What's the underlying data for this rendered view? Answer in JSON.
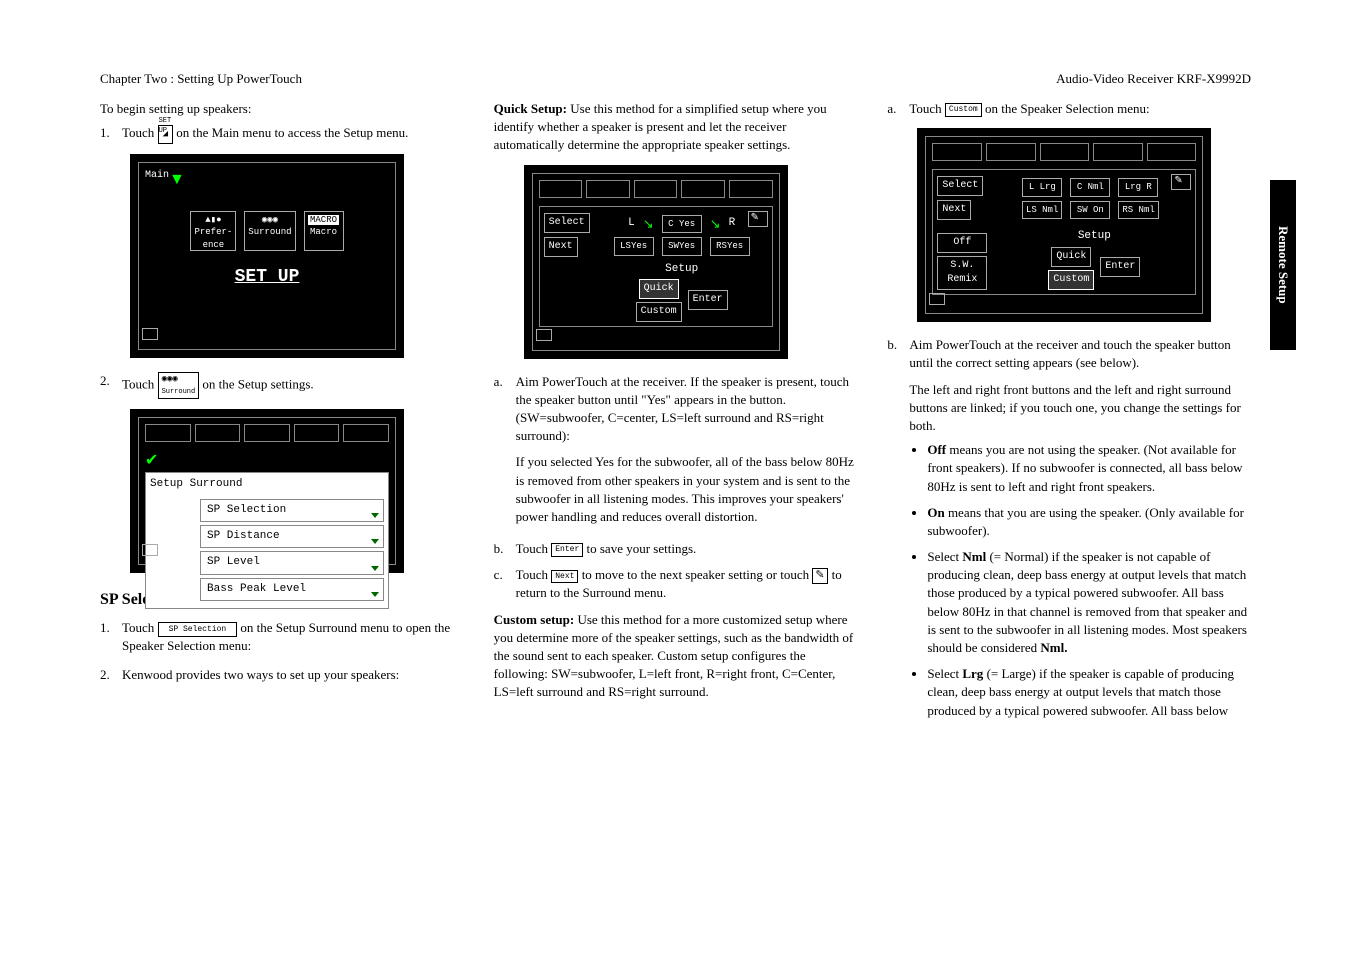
{
  "header": {
    "chapter": "Chapter Two : Setting Up PowerTouch",
    "product": "Audio-Video Receiver KRF-X9992D"
  },
  "side_tab": "Remote Setup",
  "col1": {
    "intro": "To begin setting up speakers:",
    "step1_pre": "Touch ",
    "step1_icon_label": "SET UP",
    "step1_post": " on the Main menu to access the Setup menu.",
    "screen1": {
      "main_label": "Main",
      "items": [
        "Prefer-\nence",
        "Surround",
        "Macro"
      ],
      "macro_box": "MACRO",
      "big": "SET UP"
    },
    "step2_pre": "Touch ",
    "step2_post": " on the Setup settings.",
    "screen2": {
      "title": "Setup Surround",
      "items": [
        "SP Selection",
        "SP Distance",
        "SP Level",
        "Bass Peak Level"
      ]
    },
    "section_heading": "SP Selection",
    "sp_step1_pre": "Touch ",
    "sp_step1_btn": "SP Selection",
    "sp_step1_post": " on the Setup Surround menu to open the Speaker Selection menu:",
    "sp_step2": "Kenwood provides two ways to set up your speakers:"
  },
  "col2": {
    "quick_setup_label": "Quick Setup:",
    "quick_setup_text": "  Use this method for a simplified setup where you identify whether a speaker is present and let the receiver automatically determine the appropriate speaker settings.",
    "screen3": {
      "select": "Select",
      "next": "Next",
      "L": "L",
      "R": "R",
      "c_yes": "C Yes",
      "ls": "LSYes",
      "sw": "SWYes",
      "rs": "RSYes",
      "setup": "Setup",
      "quick": "Quick",
      "custom": "Custom",
      "enter": "Enter"
    },
    "sub_a": "Aim PowerTouch at the receiver. If the speaker is present, touch the speaker button until \"Yes\" appears in the button. (SW=subwoofer, C=center, LS=left surround and RS=right surround):",
    "sub_a_para2": "If you selected Yes for the subwoofer, all of the bass below 80Hz is removed from other speakers in your system and is sent to the subwoofer in all listening modes. This improves your speakers' power handling and reduces overall distortion.",
    "sub_b_pre": "Touch ",
    "sub_b_btn": "Enter",
    "sub_b_post": " to save your settings.",
    "sub_c_pre": "Touch ",
    "sub_c_btn": "Next",
    "sub_c_mid": " to move to the next speaker setting or touch ",
    "sub_c_post": " to return to the Surround menu.",
    "custom_label": "Custom setup:",
    "custom_text": "  Use this method for a more customized setup where you determine more of the speaker settings, such as the bandwidth of the sound sent to each speaker. Custom setup configures the following: SW=subwoofer, L=left front, R=right front, C=Center, LS=left surround and RS=right surround."
  },
  "col3": {
    "sub_a_pre": "Touch ",
    "sub_a_btn": "Custom",
    "sub_a_post": " on the Speaker Selection menu:",
    "screen4": {
      "select": "Select",
      "next": "Next",
      "l_lrg": "L Lrg",
      "c_nml": "C Nml",
      "lrg_r": "Lrg R",
      "ls_nml": "LS Nml",
      "sw_on": "SW On",
      "rs_nml": "RS Nml",
      "off": "Off",
      "sw_remix": "S.W.\nRemix",
      "setup": "Setup",
      "quick": "Quick",
      "custom": "Custom",
      "enter": "Enter"
    },
    "sub_b": "Aim PowerTouch at the receiver and touch the speaker button until the correct setting appears (see below).",
    "sub_b_para2": "The left and right front buttons and the left and right surround buttons are linked; if you touch one, you change the settings for both.",
    "bullets": {
      "off_label": "Off",
      "off_text": " means you are not using the speaker. (Not available for front speakers). If no subwoofer is connected, all bass below 80Hz is sent to left and right front speakers.",
      "on_label": "On",
      "on_text": " means that you are using the speaker. (Only available for subwoofer).",
      "nml_pre": "Select ",
      "nml_label": "Nml",
      "nml_mid": " (= Normal) if the speaker is not capable of producing clean, deep bass energy at output levels that match those produced by a typical powered subwoofer. All bass below 80Hz in that channel is removed from that speaker and is sent to the subwoofer in all listening modes. Most speakers should be considered ",
      "nml_end": "Nml.",
      "lrg_pre": "Select ",
      "lrg_label": "Lrg",
      "lrg_text": " (= Large) if the speaker is capable of producing clean, deep bass energy at output levels that match those produced by a typical powered subwoofer. All bass below"
    }
  }
}
